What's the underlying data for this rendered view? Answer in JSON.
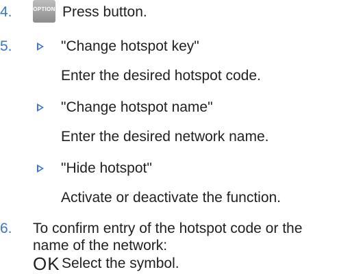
{
  "steps": [
    {
      "number": "4.",
      "button_label": "OPTION",
      "text": "Press button."
    },
    {
      "number": "5.",
      "items": [
        {
          "label": "\"Change hotspot key\"",
          "detail": "Enter the desired hotspot code."
        },
        {
          "label": "\"Change hotspot name\"",
          "detail": "Enter the desired network name."
        },
        {
          "label": "\"Hide hotspot\"",
          "detail": "Activate or deactivate the function."
        }
      ]
    },
    {
      "number": "6.",
      "text_line1": "To confirm entry of the hotspot code or the",
      "text_line2": "name of the network:",
      "symbol": "OK",
      "symbol_text": "Select the symbol."
    }
  ],
  "colors": {
    "accent": "#3a76c4",
    "text": "#1f1f1f",
    "button": "#9e9e9e"
  }
}
